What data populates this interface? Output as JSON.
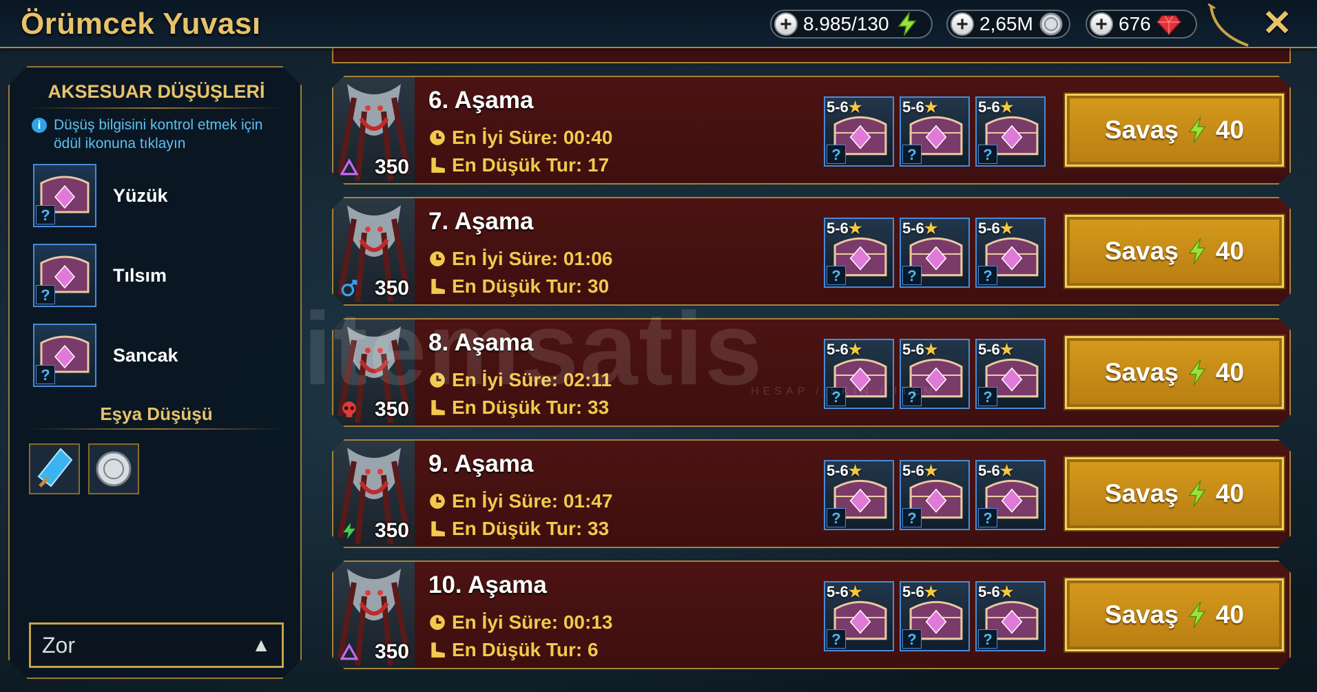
{
  "header": {
    "title": "Örümcek Yuvası",
    "energy": "8.985/130",
    "silver": "2,65M",
    "gems": "676"
  },
  "left_panel": {
    "accessory_drops_title": "AKSESUAR DÜŞÜŞLERİ",
    "info_text": "Düşüş bilgisini kontrol etmek için ödül ikonuna tıklayın",
    "accessories": [
      {
        "label": "Yüzük"
      },
      {
        "label": "Tılsım"
      },
      {
        "label": "Sancak"
      }
    ],
    "item_drops_title": "Eşya Düşüşü",
    "difficulty": "Zor"
  },
  "stages": [
    {
      "name": "6. Aşama",
      "best_time": "En İyi Süre: 00:40",
      "min_turns": "En Düşük Tur: 17",
      "level": "350",
      "affinity": "void"
    },
    {
      "name": "7. Aşama",
      "best_time": "En İyi Süre: 01:06",
      "min_turns": "En Düşük Tur: 30",
      "level": "350",
      "affinity": "magic"
    },
    {
      "name": "8. Aşama",
      "best_time": "En İyi Süre: 02:11",
      "min_turns": "En Düşük Tur: 33",
      "level": "350",
      "affinity": "force"
    },
    {
      "name": "9. Aşama",
      "best_time": "En İyi Süre: 01:47",
      "min_turns": "En Düşük Tur: 33",
      "level": "350",
      "affinity": "spirit"
    },
    {
      "name": "10. Aşama",
      "best_time": "En İyi Süre: 00:13",
      "min_turns": "En Düşük Tur: 6",
      "level": "350",
      "affinity": "void"
    }
  ],
  "reward_rank": "5-6",
  "reward_unknown": "?",
  "fight_label": "Savaş",
  "fight_cost": "40",
  "watermark": "itemsatis",
  "watermark_sub": "HESAP / SKIN / ITEM",
  "colors": {
    "gold": "#e8c26a",
    "stage_bg": "#4c1312",
    "button": "#d59a1c",
    "info_blue": "#5ec0f2"
  }
}
